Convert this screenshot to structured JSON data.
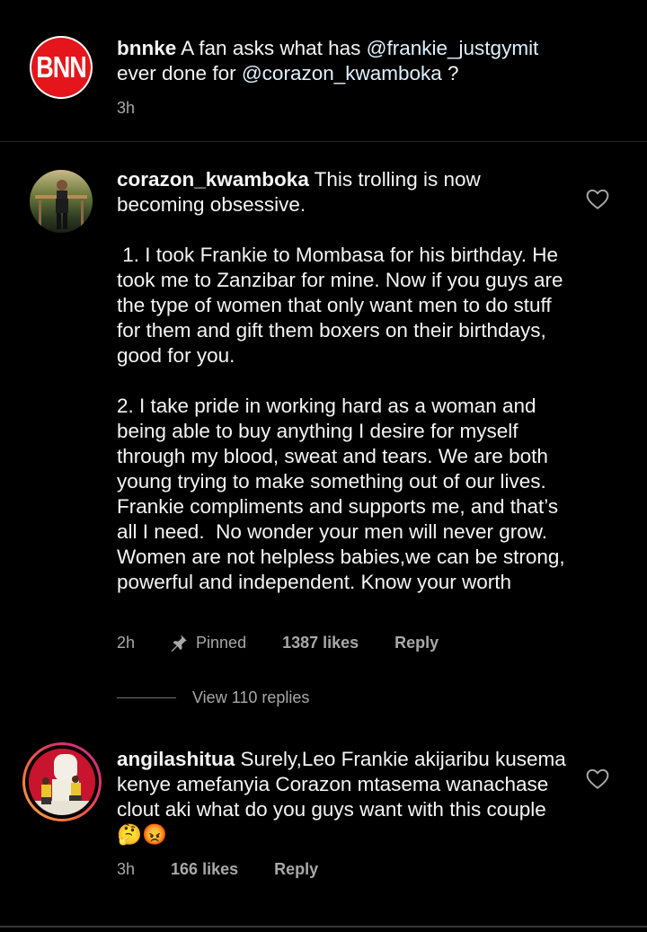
{
  "caption": {
    "avatar_text": "BNN",
    "username": "bnnke",
    "text_before": " A fan asks what has ",
    "mention1": "@frankie_justgymit",
    "text_mid": " ever done for ",
    "mention2": "@corazon_kwamboka",
    "text_after": " ?",
    "time": "3h"
  },
  "comments": [
    {
      "username": "corazon_kwamboka",
      "text": " This trolling is now becoming obsessive. \n\n 1. I took Frankie to Mombasa for his birthday. He took me to Zanzibar for mine. Now if you guys are the type of women that only want men to do stuff for them and gift them boxers on their birthdays, good for you. \n\n2. I take pride in working hard as a woman and being able to buy anything I desire for myself through my blood, sweat and tears. We are both young trying to make something out of our lives. Frankie compliments and supports me, and that’s all I need.  No wonder your men will never grow. Women are not helpless babies,we can be strong, powerful and independent. Know your worth",
      "time": "2h",
      "pinned": "Pinned",
      "likes": "1387 likes",
      "reply": "Reply",
      "view_replies": "View 110 replies"
    },
    {
      "username": "angilashitua",
      "text": " Surely,Leo Frankie akijaribu kusema kenye amefanyia Corazon mtasema wanachase clout aki what do you guys want with this couple ",
      "emoji": "🤔😡",
      "time": "3h",
      "likes": "166 likes",
      "reply": "Reply"
    }
  ],
  "colors": {
    "background": "#000000",
    "text": "#f5f5f5",
    "secondary": "#a8a8a8",
    "mention": "#e0f1ff",
    "bnn_red": "#e4161b",
    "story_ring_start": "#fcaf45",
    "story_ring_end": "#c13584"
  },
  "icons": [
    "heart-outline-icon",
    "pin-icon"
  ]
}
